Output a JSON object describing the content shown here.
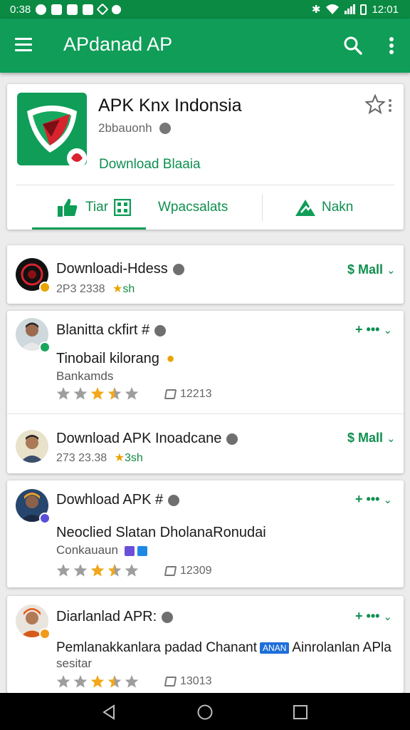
{
  "status_bar": {
    "time_left": "0:38",
    "time_right": "12:01"
  },
  "appbar": {
    "title": "APdanad AP"
  },
  "header_card": {
    "app_title": "APK Knx Indonsia",
    "developer": "2bbauonh",
    "download_link": "Download Blaaia",
    "tabs": [
      {
        "label": "Tiar"
      },
      {
        "label": "Wpacsalats"
      },
      {
        "label": "Nakn"
      }
    ],
    "colors": {
      "brand": "#0f9d58",
      "icon_red": "#d9232e"
    }
  },
  "cards": [
    {
      "name": "Downloadi-Hdess",
      "meta_left": "2P3 2338",
      "meta_right": "sh",
      "action": "$ Mall"
    },
    {
      "name": "Blanitta ckfirt #",
      "body": "Tinobail kilorang",
      "sub": "Bankamds",
      "rating": 3.5,
      "count": "12213",
      "action": "+ •••"
    },
    {
      "name": "Download APK Inoadcane",
      "meta_left": "273 23.38",
      "meta_right": "3sh",
      "action": "$ Mall"
    },
    {
      "name": "Dowhload  APK #",
      "body": "Neoclied Slatan DholanaRonudai",
      "sub": "Conkauaun",
      "rating": 3.5,
      "count": "12309",
      "action": "+ •••"
    },
    {
      "name": "Diarlanlad APR:",
      "body_start": "Pemlanakkanlara padad Chanant",
      "body_chip": "ANAN",
      "body_end": "Ainrolanlan APla",
      "sub": "sesitar",
      "rating": 3.5,
      "count": "13013",
      "action": "+ •••"
    }
  ],
  "icons": [
    "menu-icon",
    "search-icon",
    "more-vert-icon",
    "star-outline-icon",
    "thumbs-up-icon",
    "qr-icon",
    "triangle-icon",
    "verified-icon",
    "tag-icon",
    "back-icon",
    "home-icon",
    "recents-icon"
  ]
}
